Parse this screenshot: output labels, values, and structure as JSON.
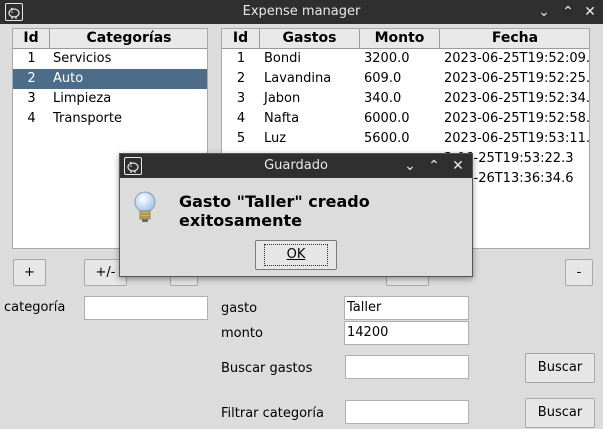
{
  "window": {
    "title": "Expense manager",
    "icon": "piggy-bank-icon"
  },
  "categories_table": {
    "headers": [
      "Id",
      "Categorías"
    ],
    "rows": [
      [
        "1",
        "Servicios"
      ],
      [
        "2",
        "Auto"
      ],
      [
        "3",
        "Limpieza"
      ],
      [
        "4",
        "Transporte"
      ]
    ],
    "selected_index": 1
  },
  "expenses_table": {
    "headers": [
      "Id",
      "Gastos",
      "Monto",
      "Fecha"
    ],
    "rows": [
      [
        "1",
        "Bondi",
        "3200.0",
        "2023-06-25T19:52:09.6"
      ],
      [
        "2",
        "Lavandina",
        "609.0",
        "2023-06-25T19:52:25.5"
      ],
      [
        "3",
        "Jabon",
        "340.0",
        "2023-06-25T19:52:34.8"
      ],
      [
        "4",
        "Nafta",
        "6000.0",
        "2023-06-25T19:52:58.0"
      ],
      [
        "5",
        "Luz",
        "5600.0",
        "2023-06-25T19:53:11.9"
      ],
      [
        "",
        "",
        "",
        "3-06-25T19:53:22.3"
      ],
      [
        "",
        "",
        "",
        "3-06-26T13:36:34.6"
      ]
    ]
  },
  "buttons": {
    "add": "+",
    "edit": "+/-",
    "remove": "-",
    "search": "Buscar",
    "filter": "Buscar"
  },
  "form": {
    "category_label": "categoría",
    "category_value": "",
    "expense_label": "gasto",
    "expense_value": "Taller",
    "amount_label": "monto",
    "amount_value": "14200",
    "search_label": "Buscar gastos",
    "search_value": "",
    "filter_label": "Filtrar categoría",
    "filter_value": ""
  },
  "dialog": {
    "title": "Guardado",
    "message": "Gasto \"Taller\" creado exitosamente",
    "ok_label": "OK",
    "icon": "lightbulb-icon"
  }
}
